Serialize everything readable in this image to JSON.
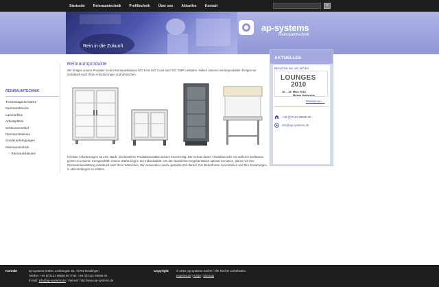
{
  "nav": {
    "items": [
      "Startseite",
      "Reinraumtechnik",
      "Profiltechnik",
      "Über uns",
      "Aktuelles",
      "Kontakt"
    ],
    "search_button": "»"
  },
  "header": {
    "slogan": "Rein in die Zukunft",
    "logo_name": "ap-systems",
    "logo_sub": "Reinraumtechnik"
  },
  "sidebar": {
    "title": "REINRAUMTECHNIK",
    "items": [
      {
        "label": "Trockenlagerschränke"
      },
      {
        "label": "Reinraumbreche"
      },
      {
        "label": "Laminarflow"
      },
      {
        "label": "Arbeitsplätze"
      },
      {
        "label": "Schleusenmöbel"
      },
      {
        "label": "Reinraumkabinen"
      },
      {
        "label": "Sonderanfertigungen"
      },
      {
        "label": "Reinraumtechnik"
      },
      {
        "label": "Reinraumklassen"
      }
    ]
  },
  "main": {
    "title": "Reinraumprodukte",
    "intro": "Wir fertigen unsere Produkte in den Reinraumklassen ISO 8 bis ISO 3 und nach EG GMP Leitfaden. Neben unseren Serienprodukten fertigen wir individuell nach Ihren Anforderungen und Wünschen.",
    "text2": "Höchste Anforderungen an eine staub- und keimfreie Produktionsstätte sichern Ihren Erfolg. Der Schutz dieser Arbeitsbereiche vor äußeren Einflüssen gehört zu unseren Kerngeschäft. Unsere Stärke liegt in der Individualität. Um den räumlichen Gegebenheiten optimal zu nutzen, planen wir Ihre Reinraumausstattung individuell nach Ihren Wünschen. Wir verwenden unsere gesamte Zeit darauf, Ihre Bedürfnisse zu verstehen und Ihre Erwartungen in allen Belangen zu erfüllen."
  },
  "aside": {
    "title": "AKTUELLES",
    "visit_text": "Besuchen Sie uns auf der",
    "lounges_line1": "LOUNGES",
    "lounges_line2": "2010",
    "lounges_date": "16. - 18. März 2010",
    "lounges_place": "Messe Karlsruhe",
    "more_link": "Weiterlesen ...",
    "phone": "+49 (0)7121 69608 60",
    "email": "info@ap-systems.de"
  },
  "footer": {
    "contact_label": "Kontakt",
    "contact_line1": "ap-systems GmbH, Lembergstr. 54, 72766 Reutlingen",
    "contact_line2": "Telefon: +49 (0)7121 69608 60 / Fax: +49 (0)7121 69608 66",
    "contact_line3_prefix": "E-Mail: ",
    "contact_email": "info@ap-systems.de",
    "contact_line3_sep": " / Internet: ",
    "contact_web": "http://www.ap-systems.de",
    "copyright_label": "Copyright",
    "copyright_text": "© 2010, ap-systems GmbH / Alle Rechte vorbehalten.",
    "impressum": "Impressum",
    "agbs": "AGBs",
    "sitemap": "Sitemap",
    "sep": " | "
  },
  "colors": {
    "accent": "#4a53b4",
    "banner": "#8f97d6",
    "dark": "#1e1e1e"
  }
}
